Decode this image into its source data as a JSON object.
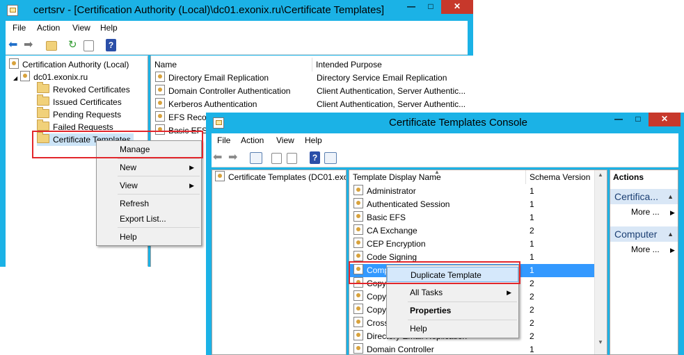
{
  "back_window": {
    "title": "certsrv - [Certification Authority (Local)\\dc01.exonix.ru\\Certificate Templates]",
    "menu": [
      "File",
      "Action",
      "View",
      "Help"
    ],
    "tree": {
      "root": "Certification Authority (Local)",
      "server": "dc01.exonix.ru",
      "folders": [
        "Revoked Certificates",
        "Issued Certificates",
        "Pending Requests",
        "Failed Requests",
        "Certificate Templates"
      ]
    },
    "columns": [
      "Name",
      "Intended Purpose"
    ],
    "rows": [
      {
        "name": "Directory Email Replication",
        "purpose": "Directory Service Email Replication"
      },
      {
        "name": "Domain Controller Authentication",
        "purpose": "Client Authentication, Server Authentic..."
      },
      {
        "name": "Kerberos Authentication",
        "purpose": "Client Authentication, Server Authentic..."
      },
      {
        "name": "EFS Recov",
        "purpose": ""
      },
      {
        "name": "Basic EFS",
        "purpose": ""
      }
    ],
    "context_menu": [
      "Manage",
      "New",
      "View",
      "Refresh",
      "Export List...",
      "Help"
    ]
  },
  "front_window": {
    "title": "Certificate Templates Console",
    "menu": [
      "File",
      "Action",
      "View",
      "Help"
    ],
    "tree_root": "Certificate Templates (DC01.exo",
    "columns": [
      "Template Display Name",
      "Schema Version"
    ],
    "rows": [
      {
        "name": "Administrator",
        "version": "1"
      },
      {
        "name": "Authenticated Session",
        "version": "1"
      },
      {
        "name": "Basic EFS",
        "version": "1"
      },
      {
        "name": "CA Exchange",
        "version": "2"
      },
      {
        "name": "CEP Encryption",
        "version": "1"
      },
      {
        "name": "Code Signing",
        "version": "1"
      },
      {
        "name": "Comp",
        "version": "1"
      },
      {
        "name": "Copy",
        "version": "2"
      },
      {
        "name": "Copy",
        "version": "2"
      },
      {
        "name": "Copy",
        "version": "2"
      },
      {
        "name": "Cross",
        "version": "2"
      },
      {
        "name": "Directory Email Replication",
        "version": "2"
      },
      {
        "name": "Domain Controller",
        "version": "1"
      }
    ],
    "context_menu": [
      "Duplicate Template",
      "All Tasks",
      "Properties",
      "Help"
    ],
    "actions": {
      "header": "Actions",
      "sections": [
        {
          "title": "Certifica...",
          "more": "More ..."
        },
        {
          "title": "Computer",
          "more": "More ..."
        }
      ]
    }
  },
  "colors": {
    "titlebar": "#1bb2e6",
    "close": "#c7382b",
    "highlight": "#3399ff",
    "annotation": "#e2262b"
  }
}
